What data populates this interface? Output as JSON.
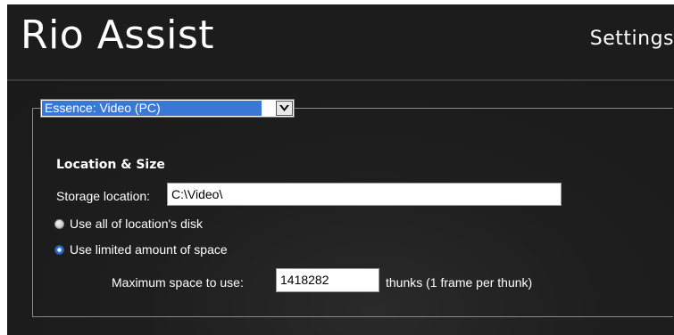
{
  "app": {
    "title": "Rio Assist",
    "page_title": "Settings"
  },
  "essence": {
    "selected": "Essence: Video (PC)"
  },
  "location_size": {
    "section_title": "Location & Size",
    "storage_label": "Storage location:",
    "storage_value": "C:\\Video\\",
    "radio_all_disk": "Use all of location's disk",
    "radio_limited": "Use limited amount of space",
    "selected_radio": "limited",
    "max_space_label": "Maximum space to use:",
    "max_space_value": "1418282",
    "max_space_unit": "thunks (1 frame per thunk)"
  },
  "colors": {
    "background": "#1c1c1c",
    "select_highlight": "#3a78d8",
    "text": "#ffffff"
  }
}
